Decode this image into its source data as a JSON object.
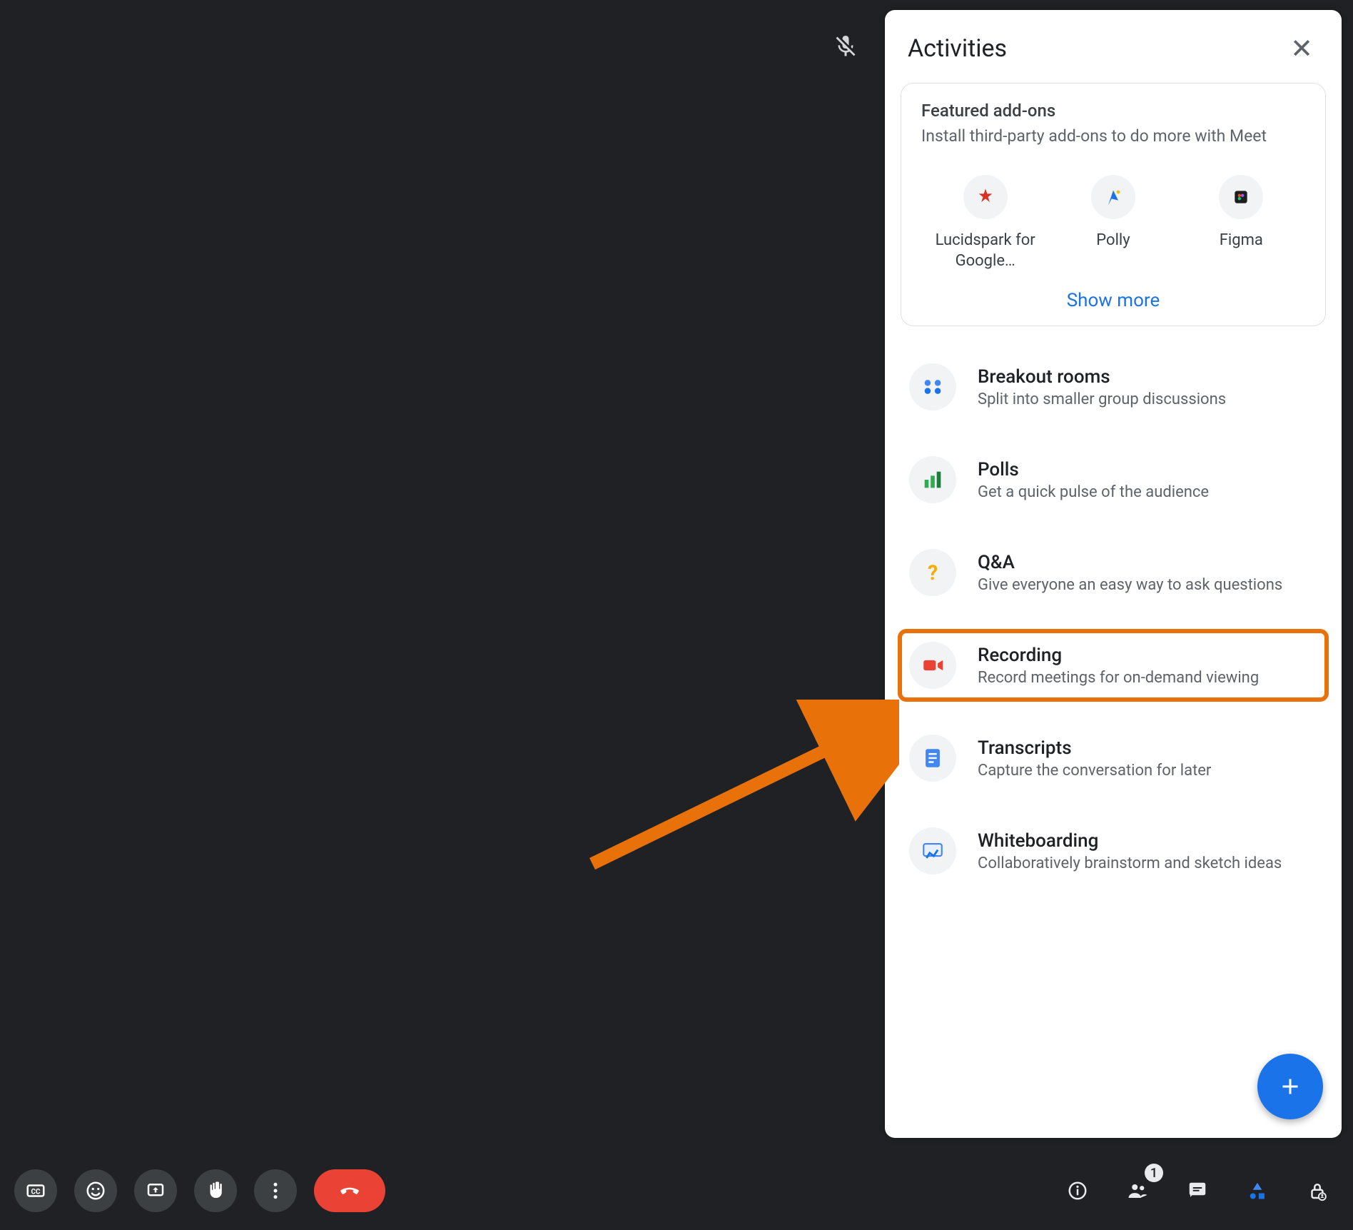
{
  "panel": {
    "title": "Activities",
    "addons": {
      "heading": "Featured add-ons",
      "subheading": "Install third-party add-ons to do more with Meet",
      "items": [
        {
          "label": "Lucidspark for Google…"
        },
        {
          "label": "Polly"
        },
        {
          "label": "Figma"
        }
      ],
      "show_more": "Show more"
    },
    "activities": [
      {
        "title": "Breakout rooms",
        "desc": "Split into smaller group discussions",
        "icon": "breakout"
      },
      {
        "title": "Polls",
        "desc": "Get a quick pulse of the audience",
        "icon": "polls"
      },
      {
        "title": "Q&A",
        "desc": "Give everyone an easy way to ask questions",
        "icon": "qa"
      },
      {
        "title": "Recording",
        "desc": "Record meetings for on-demand viewing",
        "icon": "recording",
        "highlighted": true
      },
      {
        "title": "Transcripts",
        "desc": "Capture the conversation for later",
        "icon": "transcripts"
      },
      {
        "title": "Whiteboarding",
        "desc": "Collaboratively brainstorm and sketch ideas",
        "icon": "whiteboard"
      }
    ]
  },
  "bottom_bar": {
    "participant_count": "1"
  },
  "colors": {
    "accent": "#1a73e8",
    "danger": "#ea4335",
    "highlight": "#e8710a"
  }
}
